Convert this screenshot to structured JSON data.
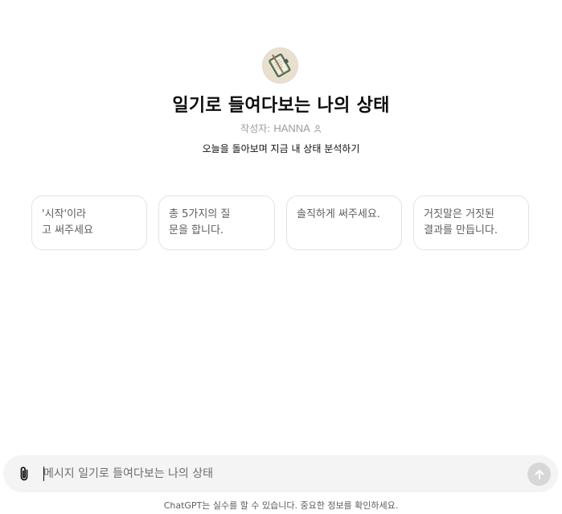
{
  "gpt": {
    "title": "일기로 들여다보는 나의 상태",
    "author_prefix": "작성자:",
    "author_name": "HANNA",
    "description": "오늘을 돌아보며 지금 내 상태 분석하기",
    "avatar_icon": "diary-notebook-icon"
  },
  "starters": [
    {
      "line1": "'시작'이라",
      "line2": "고 써주세요"
    },
    {
      "line1": "총 5가지의 질",
      "line2": "문을 합니다."
    },
    {
      "line1": "솔직하게 써주세요.",
      "line2": ""
    },
    {
      "line1": "거짓말은 거짓된",
      "line2": "결과를 만듭니다."
    }
  ],
  "composer": {
    "placeholder": "메시지 일기로 들여다보는 나의 상태",
    "attach_icon": "paperclip-icon",
    "send_icon": "arrow-up-icon"
  },
  "footer": {
    "disclaimer": "ChatGPT는 실수를 할 수 있습니다. 중요한 정보를 확인하세요."
  },
  "colors": {
    "composer_bg": "#f4f4f4",
    "send_disabled": "#d7d7d7",
    "muted_text": "#9b9b9b",
    "card_border": "#e3e3e3"
  }
}
